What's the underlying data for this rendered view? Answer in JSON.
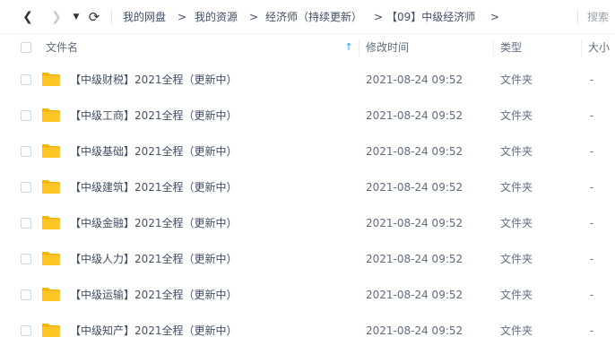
{
  "nav": {
    "back_glyph": "❮",
    "forward_glyph": "❯",
    "dropdown_glyph": "▼",
    "refresh_glyph": "⟳"
  },
  "breadcrumb": {
    "items": [
      "我的网盘",
      "我的资源",
      "经济师（持续更新）",
      "【09】中级经济师"
    ],
    "separator": ">"
  },
  "search": {
    "label": "搜索"
  },
  "table": {
    "headers": {
      "name": "文件名",
      "modified": "修改时间",
      "type": "类型",
      "size": "大小"
    },
    "sort_glyph": "↑",
    "rows": [
      {
        "name": "【中级财税】2021全程（更新中）",
        "modified": "2021-08-24 09:52",
        "type": "文件夹",
        "size": "-"
      },
      {
        "name": "【中级工商】2021全程（更新中）",
        "modified": "2021-08-24 09:52",
        "type": "文件夹",
        "size": "-"
      },
      {
        "name": "【中级基础】2021全程（更新中）",
        "modified": "2021-08-24 09:52",
        "type": "文件夹",
        "size": "-"
      },
      {
        "name": "【中级建筑】2021全程（更新中）",
        "modified": "2021-08-24 09:52",
        "type": "文件夹",
        "size": "-"
      },
      {
        "name": "【中级金融】2021全程（更新中）",
        "modified": "2021-08-24 09:52",
        "type": "文件夹",
        "size": "-"
      },
      {
        "name": "【中级人力】2021全程（更新中）",
        "modified": "2021-08-24 09:52",
        "type": "文件夹",
        "size": "-"
      },
      {
        "name": "【中级运输】2021全程（更新中）",
        "modified": "2021-08-24 09:52",
        "type": "文件夹",
        "size": "-"
      },
      {
        "name": "【中级知产】2021全程（更新中）",
        "modified": "2021-08-24 09:52",
        "type": "文件夹",
        "size": "-"
      }
    ]
  },
  "colors": {
    "folder": "#ffc524",
    "folder_tab": "#f5b300",
    "accent": "#06a7ff"
  },
  "icons": {
    "folder": "folder-icon",
    "sort": "sort-ascending-icon"
  }
}
